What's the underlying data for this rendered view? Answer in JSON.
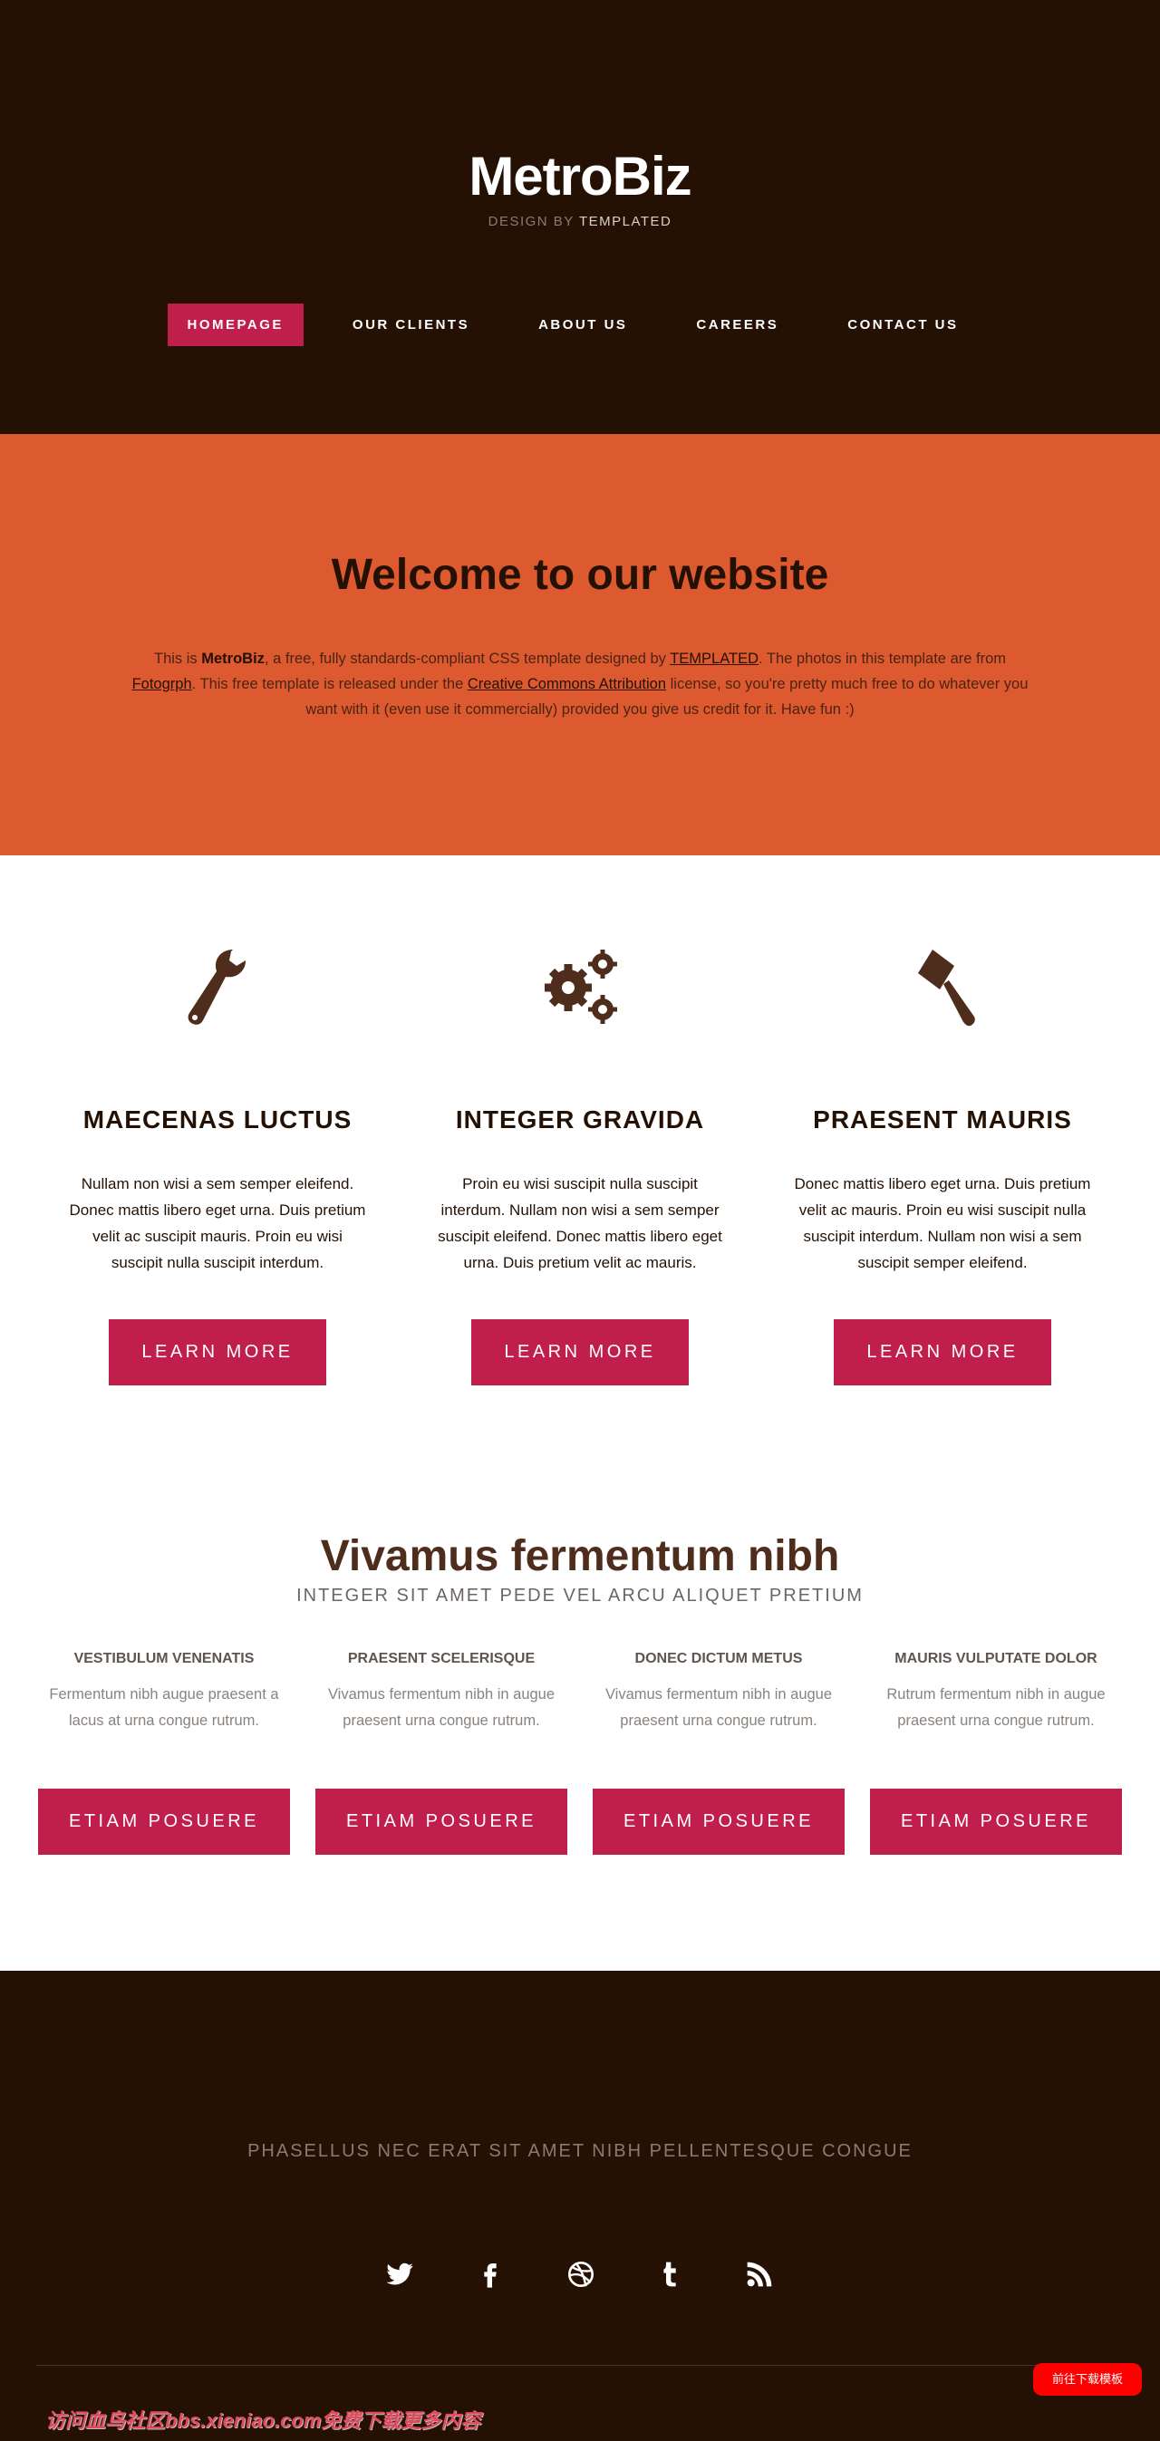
{
  "colors": {
    "header_bg": "#241104",
    "accent": "#c01f4c",
    "welcome_bg": "#dd5930",
    "icon": "#4f2d1d"
  },
  "header": {
    "logo": "MetroBiz",
    "tagline_prefix": "DESIGN BY",
    "tagline_brand": "TEMPLATED",
    "nav": [
      {
        "label": "HOMEPAGE",
        "active": true
      },
      {
        "label": "OUR CLIENTS"
      },
      {
        "label": "ABOUT US"
      },
      {
        "label": "CAREERS"
      },
      {
        "label": "CONTACT US"
      }
    ]
  },
  "welcome": {
    "title": "Welcome to our website",
    "p1": "This is ",
    "brand": "MetroBiz",
    "p2": ", a free, fully standards-compliant CSS template designed by ",
    "link1": "TEMPLATED",
    "p3": ". The photos in this template are from ",
    "link2": "Fotogrph",
    "p4": ". This free template is released under the ",
    "link3": "Creative Commons Attribution",
    "p5": " license, so you're pretty much free to do whatever you want with it (even use it commercially) provided you give us credit for it. Have fun :)"
  },
  "features": [
    {
      "icon": "wrench-icon",
      "title": "MAECENAS LUCTUS",
      "text": "Nullam non wisi a sem semper eleifend. Donec mattis libero eget urna. Duis pretium velit ac suscipit mauris. Proin eu wisi suscipit nulla suscipit interdum.",
      "button": "LEARN MORE"
    },
    {
      "icon": "gears-icon",
      "title": "INTEGER GRAVIDA",
      "text": "Proin eu wisi suscipit nulla suscipit interdum. Nullam non wisi a sem semper suscipit eleifend. Donec mattis libero eget urna. Duis pretium velit ac mauris.",
      "button": "LEARN MORE"
    },
    {
      "icon": "gavel-icon",
      "title": "PRAESENT MAURIS",
      "text": "Donec mattis libero eget urna. Duis pretium velit ac mauris. Proin eu wisi suscipit nulla suscipit interdum. Nullam non wisi a sem suscipit semper eleifend.",
      "button": "LEARN MORE"
    }
  ],
  "section2": {
    "title": "Vivamus fermentum nibh",
    "subtitle": "INTEGER SIT AMET PEDE VEL ARCU ALIQUET PRETIUM",
    "columns": [
      {
        "title": "VESTIBULUM VENENATIS",
        "text": "Fermentum nibh augue praesent a lacus at urna congue rutrum.",
        "button": "ETIAM POSUERE"
      },
      {
        "title": "PRAESENT SCELERISQUE",
        "text": "Vivamus fermentum nibh in augue praesent urna congue rutrum.",
        "button": "ETIAM POSUERE"
      },
      {
        "title": "DONEC DICTUM METUS",
        "text": "Vivamus fermentum nibh in augue praesent urna congue rutrum.",
        "button": "ETIAM POSUERE"
      },
      {
        "title": "MAURIS VULPUTATE DOLOR",
        "text": "Rutrum fermentum nibh in augue praesent urna congue rutrum.",
        "button": "ETIAM POSUERE"
      }
    ]
  },
  "footer": {
    "text": "PHASELLUS NEC ERAT SIT AMET NIBH PELLENTESQUE CONGUE",
    "social": [
      "twitter-icon",
      "facebook-icon",
      "dribbble-icon",
      "tumblr-icon",
      "rss-icon"
    ]
  },
  "overlay": {
    "download_button": "前往下载模板",
    "watermark": "访问血鸟社区bbs.xieniao.com免费下载更多内容"
  }
}
